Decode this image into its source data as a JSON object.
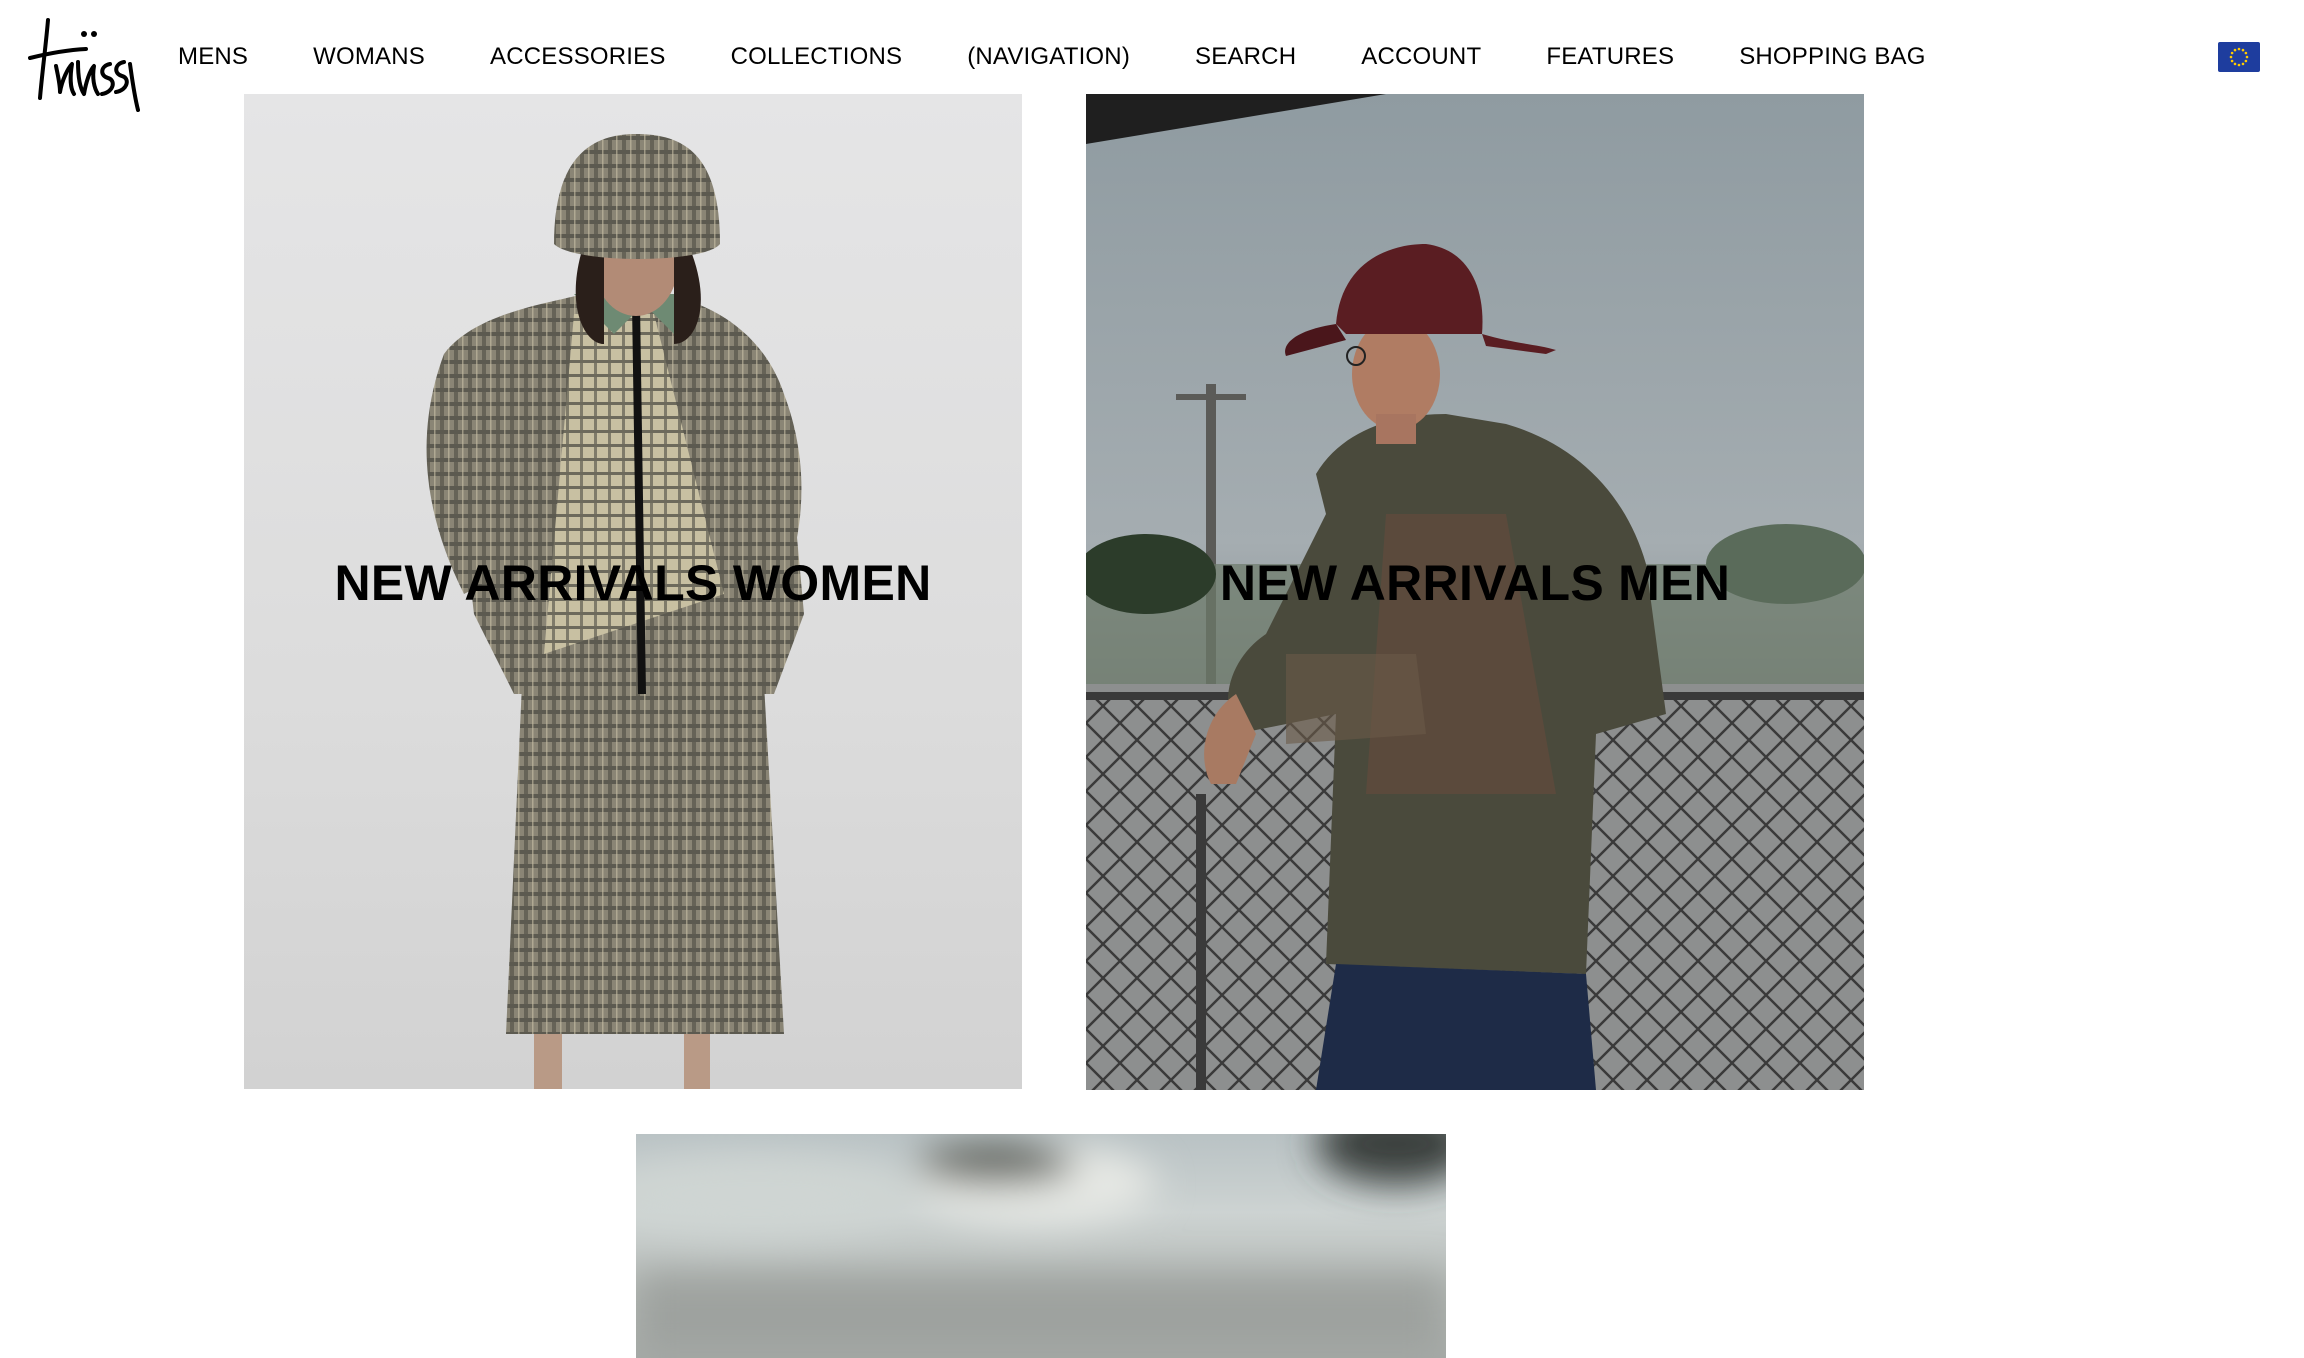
{
  "header": {
    "logo_text": "Stüssy",
    "nav": [
      {
        "label": "MENS"
      },
      {
        "label": "WOMANS"
      },
      {
        "label": "ACCESSORIES"
      },
      {
        "label": "COLLECTIONS"
      },
      {
        "label": "(NAVIGATION)"
      },
      {
        "label": "SEARCH"
      },
      {
        "label": "ACCOUNT"
      },
      {
        "label": "FEATURES"
      },
      {
        "label": "SHOPPING BAG"
      }
    ],
    "region_flag": "eu-flag-icon"
  },
  "tiles": [
    {
      "label": "NEW ARRIVALS WOMEN",
      "image": "woman-plaid-outfit-photo"
    },
    {
      "label": "NEW ARRIVALS MEN",
      "image": "man-red-cap-fence-photo"
    },
    {
      "image": "blurred-outdoor-photo"
    }
  ],
  "colors": {
    "background": "#ffffff",
    "text": "#000000",
    "flag_blue": "#1e3d9e",
    "flag_stars": "#ffcc00"
  }
}
